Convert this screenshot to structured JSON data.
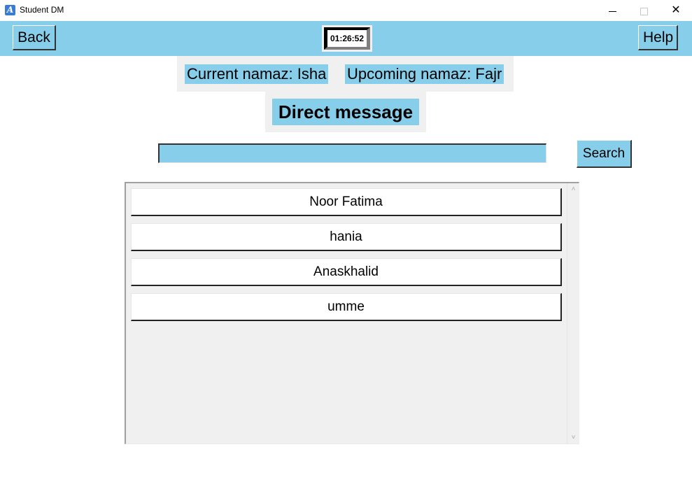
{
  "window": {
    "title": "Student DM",
    "app_icon_glyph": "A",
    "minimize_icon": "minimize-icon",
    "maximize_icon": "maximize-icon",
    "close_glyph": "✕"
  },
  "toolbar": {
    "back_label": "Back",
    "help_label": "Help",
    "clock_time": "01:26:52"
  },
  "namaz": {
    "current": "Current namaz: Isha",
    "upcoming": "Upcoming namaz: Fajr"
  },
  "heading": "Direct message",
  "search": {
    "value": "",
    "button_label": "Search"
  },
  "contacts": [
    {
      "name": "Noor Fatima"
    },
    {
      "name": "hania"
    },
    {
      "name": "Anaskhalid"
    },
    {
      "name": "umme"
    }
  ],
  "scrollbar": {
    "up_glyph": "˄",
    "down_glyph": "˅"
  },
  "colors": {
    "accent": "#87ceeb",
    "panel_bg": "#f0f0f0"
  }
}
